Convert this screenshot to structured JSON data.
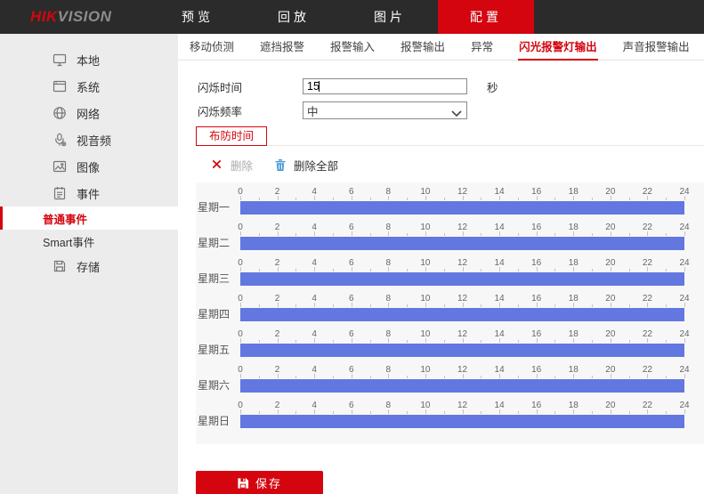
{
  "colors": {
    "accent_red": "#d4050f",
    "topbar_bg": "#2b2b2b",
    "sidebar_bg": "#ececec",
    "panel_bg": "#f7f7f7",
    "schedule_bar_blue": "#6377e0",
    "trash_blue": "#4a9bd5"
  },
  "topbar": {
    "logo": {
      "hik": "HIK",
      "vision": "VISION"
    },
    "nav": [
      {
        "id": "preview",
        "label": "预览",
        "active": false
      },
      {
        "id": "playback",
        "label": "回放",
        "active": false
      },
      {
        "id": "picture",
        "label": "图片",
        "active": false
      },
      {
        "id": "config",
        "label": "配置",
        "active": true
      }
    ]
  },
  "sidebar": {
    "items": [
      {
        "id": "local",
        "label": "本地",
        "icon": "monitor-icon",
        "child": false,
        "active": false
      },
      {
        "id": "system",
        "label": "系统",
        "icon": "window-icon",
        "child": false,
        "active": false
      },
      {
        "id": "network",
        "label": "网络",
        "icon": "globe-icon",
        "child": false,
        "active": false
      },
      {
        "id": "video-audio",
        "label": "视音频",
        "icon": "audio-video-icon",
        "child": false,
        "active": false
      },
      {
        "id": "image",
        "label": "图像",
        "icon": "image-icon",
        "child": false,
        "active": false
      },
      {
        "id": "event",
        "label": "事件",
        "icon": "event-icon",
        "child": false,
        "active": false
      },
      {
        "id": "basic-event",
        "label": "普通事件",
        "icon": "",
        "child": true,
        "active": true
      },
      {
        "id": "smart-event",
        "label": "Smart事件",
        "icon": "",
        "child": true,
        "active": false
      },
      {
        "id": "storage",
        "label": "存储",
        "icon": "storage-icon",
        "child": false,
        "active": false
      }
    ]
  },
  "tabs": [
    {
      "id": "motion-detection",
      "label": "移动侦测",
      "active": false
    },
    {
      "id": "tamper-alarm",
      "label": "遮挡报警",
      "active": false
    },
    {
      "id": "alarm-input",
      "label": "报警输入",
      "active": false
    },
    {
      "id": "alarm-output",
      "label": "报警输出",
      "active": false
    },
    {
      "id": "exception",
      "label": "异常",
      "active": false
    },
    {
      "id": "flash-alarm-light-output",
      "label": "闪光报警灯输出",
      "active": true
    },
    {
      "id": "audio-alarm-output",
      "label": "声音报警输出",
      "active": false
    }
  ],
  "form": {
    "flash_time_label": "闪烁时间",
    "flash_time_value": "15",
    "flash_time_unit": "秒",
    "flash_freq_label": "闪烁频率",
    "flash_freq_value": "中",
    "flash_freq_chevron": "chevron-down-icon"
  },
  "arming": {
    "tab_label": "布防时间",
    "tools": [
      {
        "id": "delete",
        "label": "删除",
        "icon": "close-icon",
        "disabled": true
      },
      {
        "id": "delete-all",
        "label": "删除全部",
        "icon": "trash-icon",
        "disabled": false
      }
    ]
  },
  "schedule": {
    "hours_max": 24,
    "hour_labels": [
      0,
      2,
      4,
      6,
      8,
      10,
      12,
      14,
      16,
      18,
      20,
      22,
      24
    ],
    "days": [
      {
        "label": "星期一",
        "periods": [
          {
            "start": 0,
            "end": 24
          }
        ]
      },
      {
        "label": "星期二",
        "periods": [
          {
            "start": 0,
            "end": 24
          }
        ]
      },
      {
        "label": "星期三",
        "periods": [
          {
            "start": 0,
            "end": 24
          }
        ]
      },
      {
        "label": "星期四",
        "periods": [
          {
            "start": 0,
            "end": 24
          }
        ]
      },
      {
        "label": "星期五",
        "periods": [
          {
            "start": 0,
            "end": 24
          }
        ]
      },
      {
        "label": "星期六",
        "periods": [
          {
            "start": 0,
            "end": 24
          }
        ]
      },
      {
        "label": "星期日",
        "periods": [
          {
            "start": 0,
            "end": 24
          }
        ]
      }
    ]
  },
  "save": {
    "label": "保存",
    "icon": "save-icon"
  }
}
